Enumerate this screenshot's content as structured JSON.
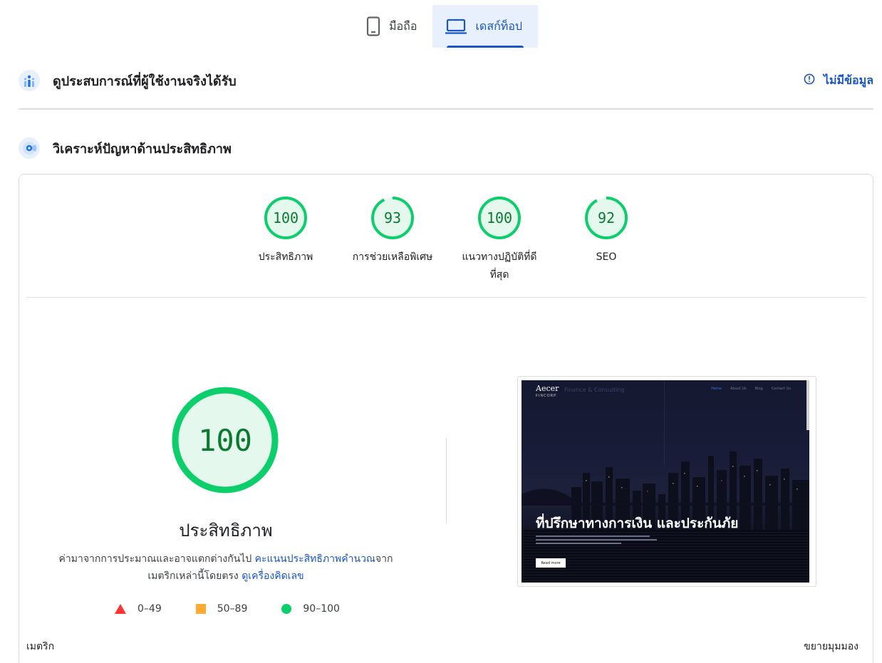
{
  "tabs": [
    {
      "label": "มือถือ",
      "icon": "phone-icon",
      "active": false
    },
    {
      "label": "เดสก์ท็อป",
      "icon": "laptop-icon",
      "active": true
    }
  ],
  "crux": {
    "title": "ดูประสบการณ์ที่ผู้ใช้งานจริงได้รับ",
    "status": "ไม่มีข้อมูล",
    "icon": "crux-chart-icon"
  },
  "diagnose": {
    "title": "วิเคราะห์ปัญหาด้านประสิทธิภาพ",
    "icon": "lighthouse-icon"
  },
  "gauges": [
    {
      "score": 100,
      "label": "ประสิทธิภาพ"
    },
    {
      "score": 93,
      "label": "การช่วยเหลือพิเศษ"
    },
    {
      "score": 100,
      "label": "แนวทางปฏิบัติที่ดีที่สุด"
    },
    {
      "score": 92,
      "label": "SEO"
    }
  ],
  "main_gauge": {
    "score": 100,
    "title": "ประสิทธิภาพ",
    "desc_prefix": "ค่ามาจากการประมาณและอาจแตกต่างกันไป ",
    "desc_link1": "คะแนนประสิทธิภาพคำนวณ",
    "desc_middle": "จากเมตริกเหล่านี้โดยตรง ",
    "desc_link2": "ดูเครื่องคิดเลข"
  },
  "legend": [
    {
      "range": "0–49",
      "shape": "triangle",
      "color": "#ff3333"
    },
    {
      "range": "50–89",
      "shape": "square",
      "color": "#ffaa33"
    },
    {
      "range": "90–100",
      "shape": "circle",
      "color": "#0cce6b"
    }
  ],
  "screenshot": {
    "brand": "Aecer",
    "brand_sub": "FINCORP",
    "tagline": "Finance & Consulting",
    "nav": [
      "Home",
      "About Us",
      "Blog",
      "Contact Us"
    ],
    "hero": "ที่ปรึกษาทางการเงิน และประกันภัย",
    "button": "Read more"
  },
  "footer": {
    "metrics": "เมตริก",
    "expand": "ขยายมุมมอง"
  },
  "colors": {
    "accent": "#1a56c5",
    "pass": "#0cce6b",
    "pass_text": "#0a7a2f",
    "pass_bg": "#e5f8ee"
  }
}
